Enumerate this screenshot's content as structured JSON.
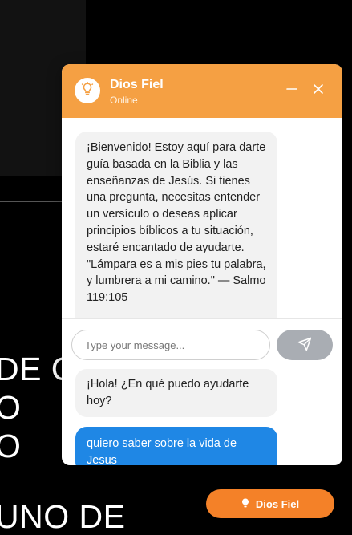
{
  "background": {
    "lines": [
      "DE Q",
      "O",
      "O",
      "UNO DE"
    ]
  },
  "chat": {
    "title": "Dios Fiel",
    "status": "Online",
    "header_icon": "lightbulb-icon",
    "minimize_icon": "minimize-icon",
    "close_icon": "close-icon",
    "colors": {
      "header": "#f5a043",
      "user_bubble": "#1f87e5",
      "bot_bubble": "#f2f2f2",
      "send_button": "#a9adb3",
      "launcher": "#f48128"
    },
    "messages": [
      {
        "role": "assistant",
        "text": "¡Bienvenido! Estoy aquí para darte guía basada en la Biblia y las enseñanzas de Jesús. Si tienes una pregunta, necesitas entender un versículo o deseas aplicar principios bíblicos a tu situación, estaré encantado de ayudarte. \"Lámpara es a mis pies tu palabra, y lumbrera a mi camino.\" — Salmo 119:105"
      },
      {
        "role": "assistant",
        "text": "¡Hola! ¿En qué puedo ayudarte hoy?"
      },
      {
        "role": "user",
        "text": "quiero saber sobre la vida de Jesus"
      }
    ],
    "input": {
      "value": "",
      "placeholder": "Type your message..."
    },
    "send_icon": "send-icon"
  },
  "launcher": {
    "label": "Dios Fiel",
    "icon": "lightbulb-icon"
  }
}
